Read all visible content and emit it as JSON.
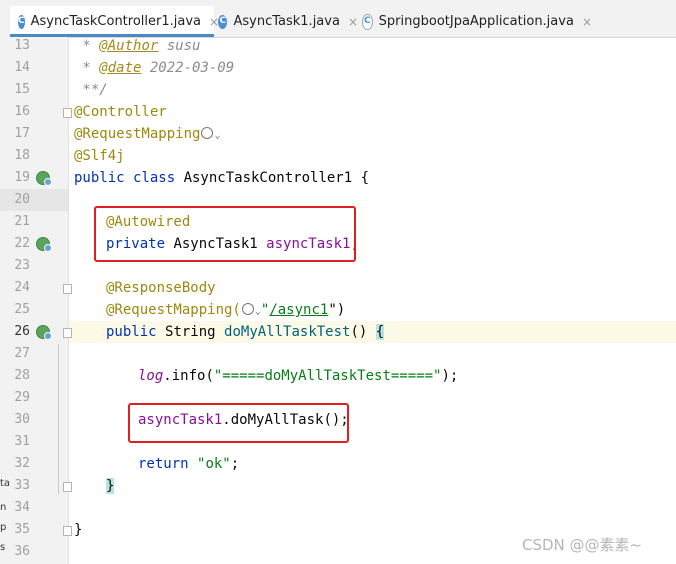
{
  "tabs": [
    {
      "name": "AsyncTaskController1.java",
      "active": true,
      "icon": "class-icon"
    },
    {
      "name": "AsyncTask1.java",
      "active": false,
      "icon": "class-icon"
    },
    {
      "name": "SpringbootJpaApplication.java",
      "active": false,
      "icon": "spring-class-icon"
    }
  ],
  "close_glyph": "×",
  "class_glyph": "C",
  "line_numbers": [
    "13",
    "14",
    "15",
    "16",
    "17",
    "18",
    "19",
    "20",
    "21",
    "22",
    "23",
    "24",
    "25",
    "26",
    "27",
    "28",
    "29",
    "30",
    "31",
    "32",
    "33",
    "34",
    "35",
    "36"
  ],
  "code": {
    "l13_star": " * ",
    "l13_tag": "@Author",
    "l13_val": " susu",
    "l14_star": " * ",
    "l14_tag": "@date",
    "l14_val": " 2022-03-09",
    "l15": " **/",
    "l16": "@Controller",
    "l17": "@RequestMapping",
    "l18": "@Slf4j",
    "l19_kw": "public class ",
    "l19_rest": "AsyncTaskController1 {",
    "l21": "@Autowired",
    "l22_kw": "private ",
    "l22_type": "AsyncTask1 ",
    "l22_field": "asyncTask1",
    "l22_end": ";",
    "l24": "@ResponseBody",
    "l25_ann": "@RequestMapping(",
    "l25_str": "\"",
    "l25_link": "/async1",
    "l25_end": "\")",
    "l26_kw": "public ",
    "l26_type": "String ",
    "l26_method": "doMyAllTaskTest",
    "l26_paren": "() ",
    "l26_brace": "{",
    "l28_log": "log",
    "l28_dot": ".info(",
    "l28_str": "\"=====doMyAllTaskTest=====\"",
    "l28_end": ");",
    "l30_field": "asyncTask1",
    "l30_rest": ".doMyAllTask();",
    "l32_kw": "return ",
    "l32_str": "\"ok\"",
    "l32_end": ";",
    "l33": "}",
    "l35": "}"
  },
  "left_stub": [
    "ta",
    "n",
    "p",
    "s"
  ],
  "watermark": "CSDN @@素素~"
}
